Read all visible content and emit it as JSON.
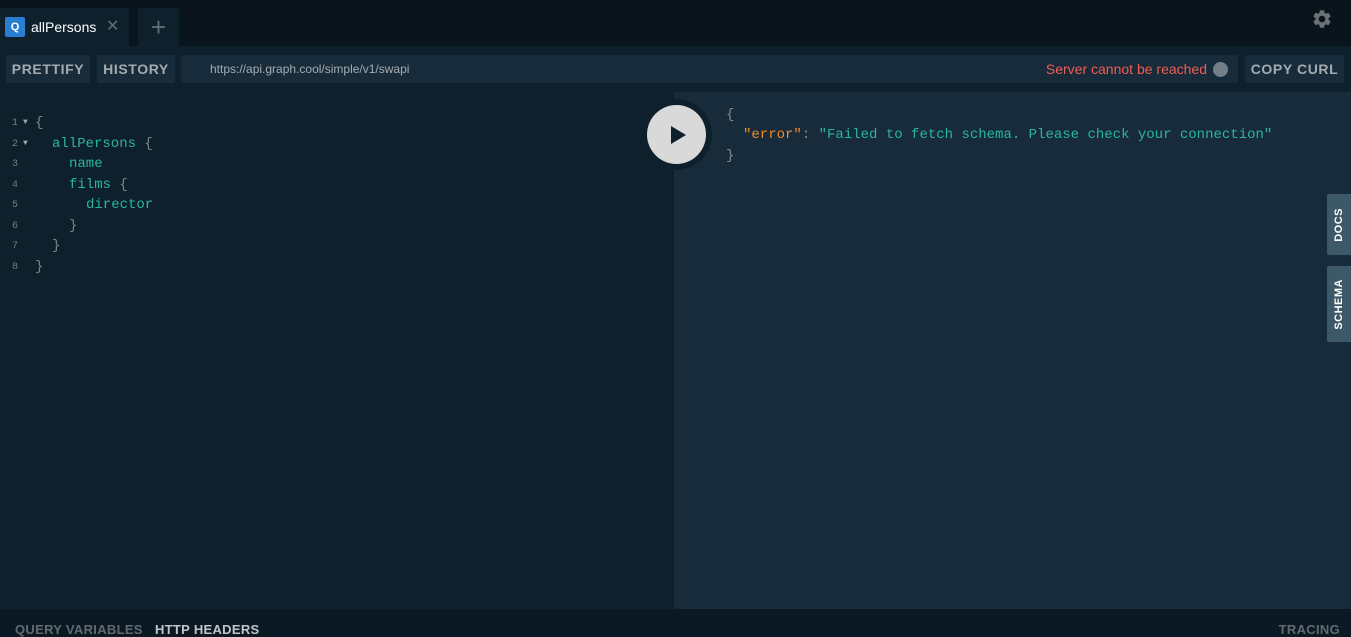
{
  "tabs": [
    {
      "badge": "Q",
      "title": "allPersons",
      "close": "✕"
    }
  ],
  "add_tab_label": "+",
  "toolbar": {
    "prettify_label": "PRETTIFY",
    "history_label": "HISTORY",
    "endpoint_url": "https://api.graph.cool/simple/v1/swapi",
    "status_text": "Server cannot be reached",
    "copy_curl_label": "COPY CURL"
  },
  "editor": {
    "line_numbers": [
      "1",
      "2",
      "3",
      "4",
      "5",
      "6",
      "7",
      "8"
    ],
    "lines": [
      {
        "text": "{",
        "kind": "punct"
      },
      {
        "text": "allPersons",
        "kind": "field",
        "suffix": " {"
      },
      {
        "text": "name",
        "kind": "field",
        "suffix": ""
      },
      {
        "text": "films",
        "kind": "field",
        "suffix": " {"
      },
      {
        "text": "director",
        "kind": "field",
        "suffix": ""
      },
      {
        "text": "}",
        "kind": "punct"
      },
      {
        "text": "}",
        "kind": "punct"
      },
      {
        "text": "}",
        "kind": "punct"
      }
    ]
  },
  "result": {
    "open_brace": "{",
    "error_key": "\"error\"",
    "colon": ": ",
    "error_value": "\"Failed to fetch schema. Please check your connection\"",
    "close_brace": "}"
  },
  "side_tabs": {
    "docs_label": "DOCS",
    "schema_label": "SCHEMA"
  },
  "bottom": {
    "query_variables_label": "QUERY VARIABLES",
    "http_headers_label": "HTTP HEADERS",
    "tracing_label": "TRACING"
  },
  "icons": {
    "settings": "gear-icon",
    "run": "play-icon",
    "status": "status-dot-icon",
    "fold": "triangle-down-icon"
  },
  "colors": {
    "accent": "#2a7ed2",
    "error": "#f25c54",
    "field": "#29b6a0",
    "key": "#f28c28"
  }
}
